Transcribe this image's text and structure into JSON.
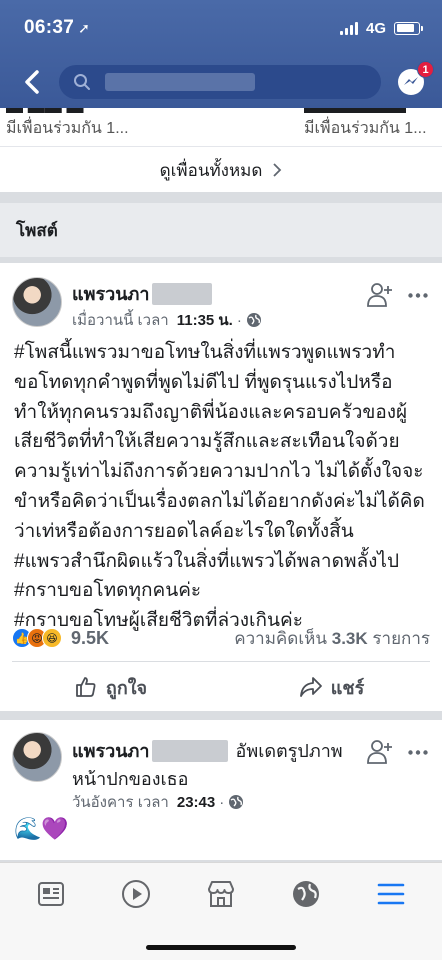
{
  "status_bar": {
    "time": "06:37",
    "network": "4G",
    "battery_level": 0.85
  },
  "header": {
    "messenger_badge": "1"
  },
  "friends": {
    "items": [
      {
        "mutual": "มีเพื่อนร่วมกัน 1..."
      },
      {
        "mutual": "มีเพื่อนร่วมกัน 1..."
      }
    ],
    "see_all": "ดูเพื่อนทั้งหมด"
  },
  "section": {
    "title": "โพสต์"
  },
  "post1": {
    "author": "แพรวนภา",
    "time_prefix": "เมื่อวานนี้ เวลา",
    "time": "11:35 น.",
    "lines": [
      "#โพสนี้แพรวมาขอโทษในสิ่งที่แพรวพูดแพรวทำ",
      "ขอโทดทุกคำพูดที่พูดไม่ดีไป ที่พูดรุนแรงไปหรือ",
      "ทำให้ทุกคนรวมถึงญาติพี่น้องและครอบครัวของผู้",
      "เสียชีวิตที่ทำให้เสียความรู้สึกและสะเทือนใจด้วย",
      "ความรู้เท่าไม่ถึงการด้วยความปากไว ไม่ได้ตั้งใจจะ",
      "ขำหรือคิดว่าเป็นเรื่องตลกไม่ได้อยากดังค่ะไม่ได้คิด",
      "ว่าเท่หรือต้องการยอดไลค์อะไรใดใดทั้งสิ้น",
      "#แพรวสำนึกผิดแร้วในสิ่งที่แพรวได้พลาดพลั้งไป",
      "#กราบขอโทดทุกคนค่ะ",
      "#กราบขอโทษผู้เสียชีวิตที่ล่วงเกินค่ะ"
    ],
    "reactions_count": "9.5K",
    "comments_label": "ความคิดเห็น",
    "comments_count": "3.3K",
    "comments_unit": "รายการ",
    "like_label": "ถูกใจ",
    "share_label": "แชร์"
  },
  "post2": {
    "author": "แพรวนภา",
    "action_text": "อัพเดตรูปภาพ",
    "action_text2": "หน้าปกของเธอ",
    "time_prefix": "วันอังคาร เวลา",
    "time": "23:43",
    "emoji": "🌊💜"
  },
  "colors": {
    "header": "#3b5998",
    "accent": "#1877f2",
    "badge": "#e41e3f"
  }
}
